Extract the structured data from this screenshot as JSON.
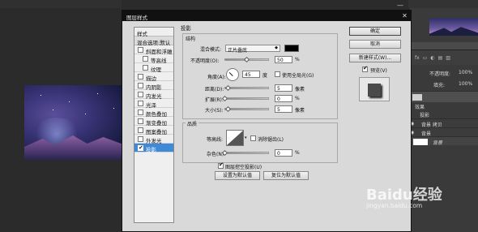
{
  "dialog": {
    "title": "图层样式",
    "styles_header": "样式",
    "blend_options": "混合选项:默认",
    "style_items": [
      {
        "label": "斜面和浮雕",
        "checked": false,
        "indent": false
      },
      {
        "label": "等高线",
        "checked": false,
        "indent": true
      },
      {
        "label": "纹理",
        "checked": false,
        "indent": true
      },
      {
        "label": "描边",
        "checked": false,
        "indent": false
      },
      {
        "label": "内阴影",
        "checked": false,
        "indent": false
      },
      {
        "label": "内发光",
        "checked": false,
        "indent": false
      },
      {
        "label": "光泽",
        "checked": false,
        "indent": false
      },
      {
        "label": "颜色叠加",
        "checked": false,
        "indent": false
      },
      {
        "label": "渐变叠加",
        "checked": false,
        "indent": false
      },
      {
        "label": "图案叠加",
        "checked": false,
        "indent": false
      },
      {
        "label": "外发光",
        "checked": false,
        "indent": false
      },
      {
        "label": "投影",
        "checked": true,
        "indent": false,
        "selected": true
      }
    ],
    "checkmark": "✔",
    "section_title": "投影",
    "structure": {
      "title": "结构",
      "blend_mode_label": "混合模式:",
      "blend_mode_value": "正片叠底",
      "shadow_color": "#000000",
      "opacity_label": "不透明度(O):",
      "opacity_value": "50",
      "opacity_unit": "%",
      "opacity_fraction": 0.5,
      "angle_label": "角度(A):",
      "angle_value": "45",
      "angle_unit": "度",
      "global_light_label": "使用全局光(G)",
      "distance_label": "距离(D):",
      "distance_value": "5",
      "distance_unit": "像素",
      "spread_label": "扩展(R):",
      "spread_value": "0",
      "spread_unit": "%",
      "size_label": "大小(S):",
      "size_value": "5",
      "size_unit": "像素"
    },
    "quality": {
      "title": "品质",
      "contour_label": "等高线:",
      "antialias_label": "消除锯齿(L)",
      "noise_label": "杂色(N):",
      "noise_value": "0",
      "noise_unit": "%"
    },
    "knockout_label": "图层挖空投影(U)",
    "make_default_button": "设置为默认值",
    "reset_default_button": "复位为默认值",
    "ok_button": "确定",
    "cancel_button": "取消",
    "new_style_button": "新建样式(W)...",
    "preview_label": "预览(V)",
    "close_glyph": "✕"
  },
  "right_panel": {
    "opacity_text": "不透明度:",
    "fill_text": "填充:",
    "percent": "100%",
    "layer_effects": "效果",
    "layer_shadow": "投影",
    "layer_copy": "背景 拷贝",
    "layer_bg": "背景",
    "layer_bg2": "背景",
    "fx": "fx"
  },
  "watermark": {
    "brand": "Baidu经验",
    "url": "jingyan.baidu.com"
  }
}
